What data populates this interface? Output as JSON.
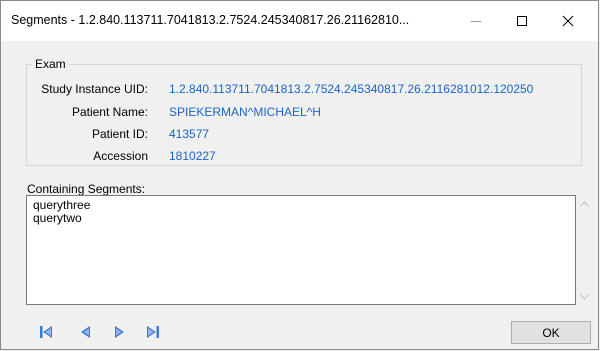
{
  "window": {
    "title": "Segments - 1.2.840.113711.7041813.2.7524.245340817.26.21162810..."
  },
  "exam": {
    "group_title": "Exam",
    "fields": [
      {
        "label": "Study Instance UID:",
        "value": "1.2.840.113711.7041813.2.7524.245340817.26.2116281012.120250"
      },
      {
        "label": "Patient Name:",
        "value": "SPIEKERMAN^MICHAEL^H"
      },
      {
        "label": "Patient ID:",
        "value": "413577"
      },
      {
        "label": "Accession",
        "value": "1810227"
      }
    ]
  },
  "segments": {
    "label": "Containing Segments:",
    "items": [
      "querythree",
      "querytwo"
    ]
  },
  "navigation": {
    "icons": [
      "first-record-icon",
      "previous-record-icon",
      "next-record-icon",
      "last-record-icon"
    ],
    "accent_color": "#3a7bd5"
  },
  "footer": {
    "ok_label": "OK"
  },
  "colors": {
    "value_text": "#1a64c8",
    "nav_accent": "#3a7bd5"
  }
}
